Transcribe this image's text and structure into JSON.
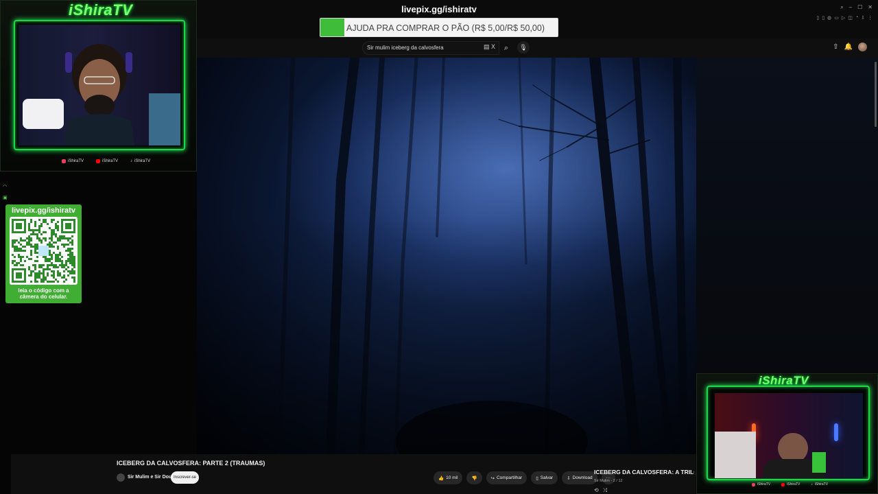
{
  "overlay": {
    "brand": "iShiraTV",
    "livepix_url": "livepix.gg/ishiratv",
    "goal": {
      "text": "AJUDA PRA COMPRAR O PÃO (R$ 5,00/R$ 50,00)",
      "progress": 0.1,
      "color": "#3fbd3a"
    },
    "socials": [
      {
        "platform": "instagram-icon",
        "handle": "iShiraTV",
        "color": "#e4405f"
      },
      {
        "platform": "youtube-icon",
        "handle": "iShiraTV",
        "color": "#ff0000"
      },
      {
        "platform": "tiktok-icon",
        "handle": "iShiraTV",
        "color": "#ffffff"
      }
    ],
    "qr_panel": {
      "url": "livepix.gg/ishiratv",
      "caption_line1": "leia o código com a",
      "caption_line2": "câmera do celular."
    },
    "accent_color": "#1fd64a"
  },
  "youtube": {
    "search": {
      "value": "Sir mulim iceberg da calvosfera",
      "clear_icon": "X"
    },
    "video": {
      "title": "ICEBERG DA CALVOSFERA: PARTE 2 (TRAUMAS)",
      "channel": "Sir Mulim e Sir Doux",
      "subscribe_label": "Inscrever-se"
    },
    "actions": {
      "likes": "10 mil",
      "share": "Compartilhar",
      "save": "Salvar",
      "download": "Download",
      "more": "···"
    },
    "playlist": {
      "title": "ICEBERG DA CALVOSFERA: A TRILOGIA (e m",
      "subtitle": "Sir Mulim - 2 / 12"
    }
  }
}
